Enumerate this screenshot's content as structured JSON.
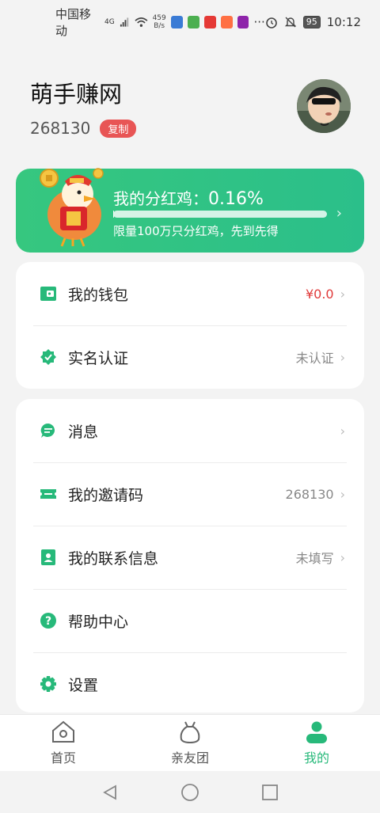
{
  "status_bar": {
    "carrier": "中国移动",
    "network": "4G",
    "speed_value": "459",
    "speed_unit": "B/s",
    "battery": "95",
    "time": "10:12",
    "more": "···"
  },
  "profile": {
    "name": "萌手赚网",
    "id": "268130",
    "copy_label": "复制"
  },
  "dividend": {
    "title_prefix": "我的分红鸡：",
    "percent": "0.16%",
    "progress": 0.0016,
    "subtitle": "限量100万只分红鸡，先到先得"
  },
  "card1": {
    "wallet_label": "我的钱包",
    "wallet_value": "¥0.0",
    "verify_label": "实名认证",
    "verify_value": "未认证"
  },
  "card2": {
    "messages_label": "消息",
    "invite_label": "我的邀请码",
    "invite_value": "268130",
    "contact_label": "我的联系信息",
    "contact_value": "未填写",
    "help_label": "帮助中心",
    "settings_label": "设置"
  },
  "bottom_nav": {
    "home": "首页",
    "group": "亲友团",
    "mine": "我的"
  },
  "colors": {
    "accent": "#27b97a",
    "copy_badge": "#e85555",
    "wallet_value": "#e03a3a"
  },
  "icons": [
    "wallet-icon",
    "verified-badge-icon",
    "message-icon",
    "ticket-icon",
    "contact-card-icon",
    "help-icon",
    "gear-icon",
    "home-icon",
    "bag-icon",
    "person-icon"
  ]
}
